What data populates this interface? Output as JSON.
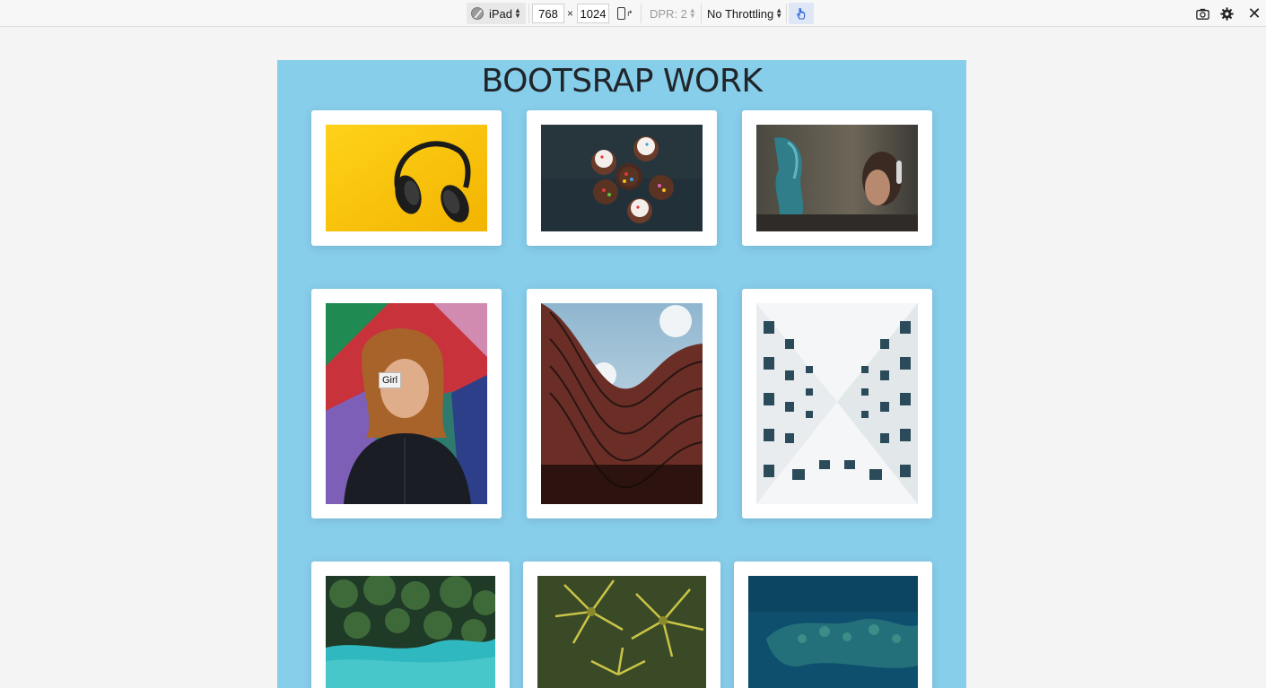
{
  "devtools": {
    "device": "iPad",
    "width": "768",
    "height": "1024",
    "times": "×",
    "dpr": "DPR: 2",
    "throttling": "No Throttling",
    "close_glyph": "✕",
    "icons": [
      "device-selector-icon",
      "rotate-icon",
      "touch-simulation-icon",
      "screenshot-icon",
      "settings-icon",
      "close-icon"
    ]
  },
  "page": {
    "title": "BOOTSRAP WORK",
    "background": "#87ceeb",
    "tooltip": "Girl",
    "images": [
      {
        "subject": "headphones on yellow background"
      },
      {
        "subject": "cupcakes with sprinkles"
      },
      {
        "subject": "graffiti wall and woman with headphones"
      },
      {
        "subject": "girl in front of graffiti",
        "title": "Girl"
      },
      {
        "subject": "curved red building facade"
      },
      {
        "subject": "white building looking up"
      },
      {
        "subject": "aerial palm trees and turquoise water"
      },
      {
        "subject": "aerial palm tree crowns"
      },
      {
        "subject": "aerial ocean reef"
      }
    ]
  }
}
